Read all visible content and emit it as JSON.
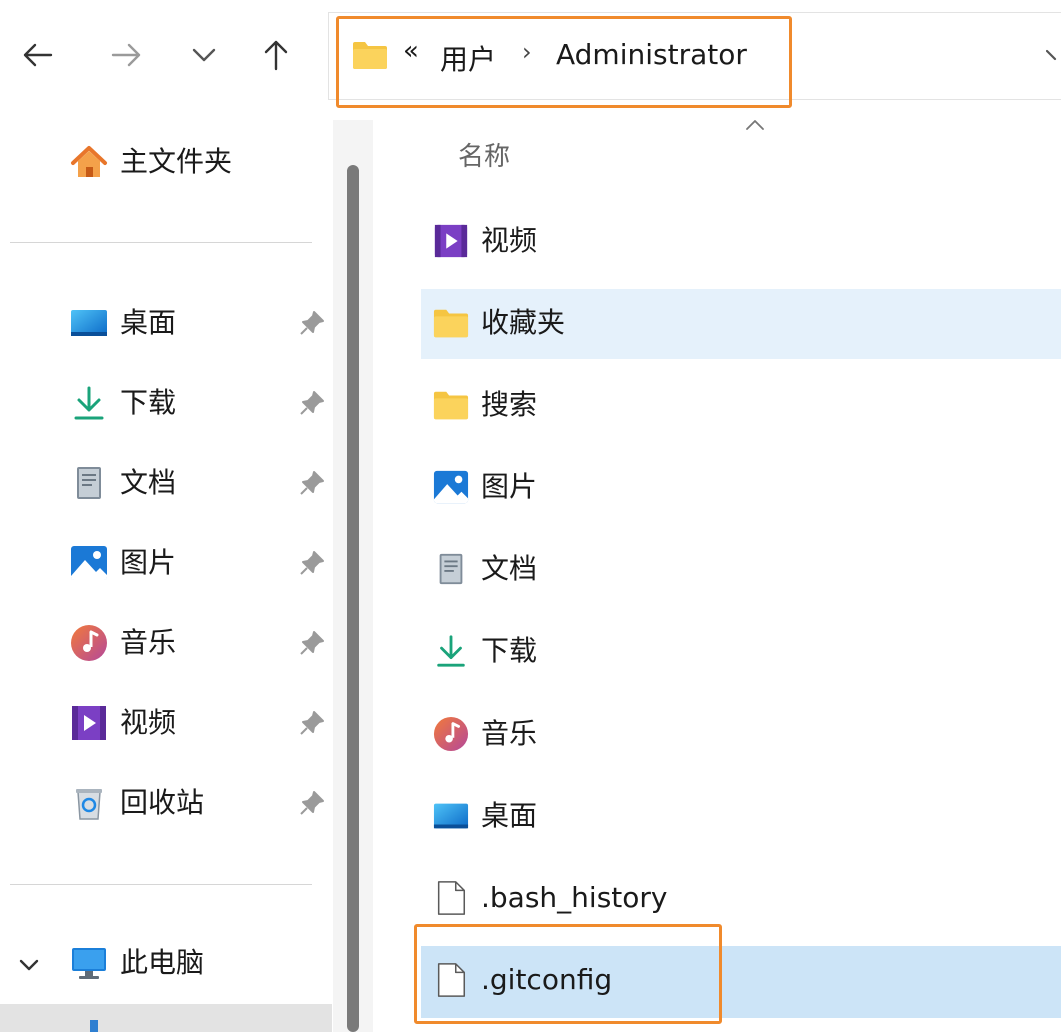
{
  "nav": {
    "back_icon": "arrow-left-icon",
    "forward_icon": "arrow-right-icon",
    "recent_icon": "chevron-down-icon",
    "up_icon": "arrow-up-icon"
  },
  "address": {
    "overflow": "«",
    "crumbs": [
      "用户",
      "Administrator"
    ],
    "separator": "›"
  },
  "sidebar": {
    "home": "主文件夹",
    "pinned": [
      {
        "label": "桌面",
        "icon": "desktop-icon"
      },
      {
        "label": "下载",
        "icon": "download-icon"
      },
      {
        "label": "文档",
        "icon": "document-icon"
      },
      {
        "label": "图片",
        "icon": "pictures-icon"
      },
      {
        "label": "音乐",
        "icon": "music-icon"
      },
      {
        "label": "视频",
        "icon": "video-icon"
      },
      {
        "label": "回收站",
        "icon": "recycle-bin-icon"
      }
    ],
    "this_pc": "此电脑"
  },
  "list": {
    "column_name": "名称",
    "items": [
      {
        "label": "视频",
        "icon": "video-icon"
      },
      {
        "label": "收藏夹",
        "icon": "folder-icon"
      },
      {
        "label": "搜索",
        "icon": "folder-icon"
      },
      {
        "label": "图片",
        "icon": "pictures-icon"
      },
      {
        "label": "文档",
        "icon": "document-icon"
      },
      {
        "label": "下载",
        "icon": "download-icon"
      },
      {
        "label": "音乐",
        "icon": "music-icon"
      },
      {
        "label": "桌面",
        "icon": "desktop-icon"
      },
      {
        "label": ".bash_history",
        "icon": "file-icon"
      },
      {
        "label": ".gitconfig",
        "icon": "file-icon"
      }
    ]
  },
  "colors": {
    "highlight": "#f08a2c",
    "selection": "#cce4f7",
    "hover": "#e5f1fb"
  }
}
